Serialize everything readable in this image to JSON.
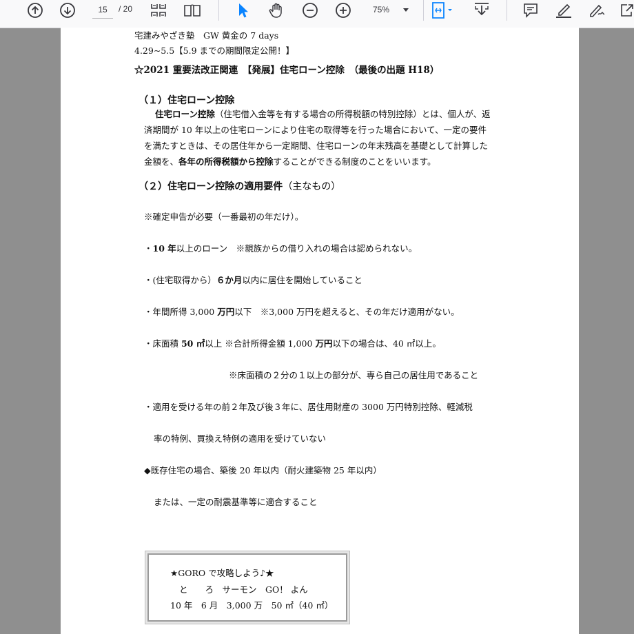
{
  "toolbar": {
    "page_current": "15",
    "page_total": "/ 20",
    "zoom": "75%",
    "icons": [
      "up-arrow-icon",
      "down-arrow-icon",
      "two-page-grid-icon",
      "book-icon",
      "pointer-icon",
      "hand-icon",
      "zoom-out-icon",
      "zoom-in-icon",
      "fit-page-icon",
      "download-icon",
      "comment-icon",
      "highlight-icon",
      "sign-icon",
      "share-icon"
    ]
  },
  "doc": {
    "header_line1": "宅建みやざき塾　GW 黄金の 7 days",
    "header_line2": "4.29~5.5【5.9 までの期間限定公開！】",
    "title": "☆2021 重要法改正関連　【発展】住宅ローン控除　（最後の出題 H18）",
    "sec1_heading": "（１）住宅ローン控除",
    "sec1_p1a": "住宅ローン控除",
    "sec1_p1b": "（住宅借入金等を有する場合の所得税額の特別控除）とは、個人が、返",
    "sec1_p2": "済期間が 10 年以上の住宅ローンにより住宅の取得等を行った場合において、一定の要件",
    "sec1_p3": "を満たすときは、その居住年から一定期間、住宅ローンの年末残高を基礎として計算した",
    "sec1_p4a": "金額を、",
    "sec1_p4b": "各年の所得税額から控除",
    "sec1_p4c": "することができる制度のことをいいます。",
    "sec2_heading_a": "（２）住宅ローン控除の適用要件",
    "sec2_heading_b": "（主なもの）",
    "r0": "※確定申告が必要（一番最初の年だけ）。",
    "r1a": "・",
    "r1b": "10 年",
    "r1c": "以上のローン　※親族からの借り入れの場合は認められない。",
    "r2a": "・(住宅取得から）",
    "r2b": "６か月",
    "r2c": "以内に居住を開始していること",
    "r3a": "・年間所得 3,000 ",
    "r3b": "万円",
    "r3c": "以下　※3,000 万円を超えると、その年だけ適用がない。",
    "r4a": "・床面積 ",
    "r4b": "50 ㎡",
    "r4c": "以上 ※合計所得金額 1,000 ",
    "r4d": "万円",
    "r4e": "以下の場合は、40 ㎡以上。",
    "r5": "※床面積の２分の１以上の部分が、専ら自己の居住用であること",
    "r6": "・適用を受ける年の前２年及び後３年に、居住用財産の 3000 万円特別控除、軽減税",
    "r7": "率の特例、買換え特例の適用を受けていない",
    "r8": "◆既存住宅の場合、築後 20 年以内（耐火建築物 25 年以内）",
    "r9": "または、一定の耐震基準等に適合すること",
    "memo1": "★GORO で攻略しよう♪★",
    "memo2": "と　　ろ　サーモン　GO！ よん",
    "memo3": "10 年　6 月　3,000 万　50 ㎡（40 ㎡）"
  }
}
